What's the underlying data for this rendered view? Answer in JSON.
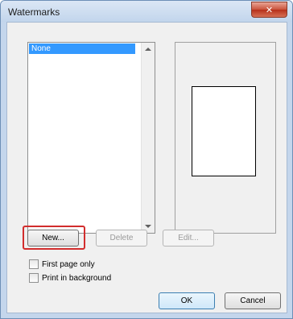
{
  "window": {
    "title": "Watermarks",
    "close_symbol": "✕"
  },
  "watermark_list": {
    "items": [
      {
        "label": "None",
        "selected": true
      }
    ]
  },
  "buttons": {
    "new_label": "New...",
    "delete_label": "Delete",
    "edit_label": "Edit...",
    "ok_label": "OK",
    "cancel_label": "Cancel"
  },
  "options": {
    "first_page_only": {
      "label": "First page only",
      "checked": false
    },
    "print_in_background": {
      "label": "Print in background",
      "checked": false
    }
  },
  "colors": {
    "selection": "#3399ff",
    "highlight": "#d22d2d"
  }
}
